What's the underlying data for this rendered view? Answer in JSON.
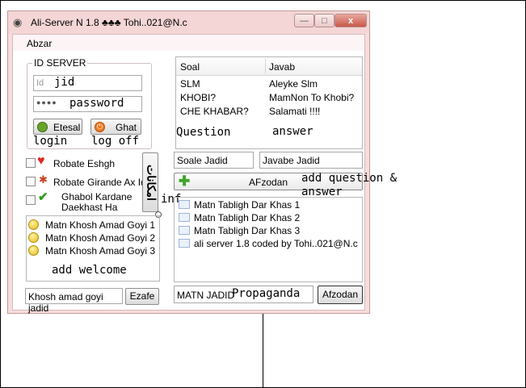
{
  "window": {
    "title": "Ali-Server N 1.8 ♣♣♣  Tohi..021@N.c",
    "menu": "Abzar",
    "close_glyph": "x",
    "minimize_glyph": "—",
    "maximize_glyph": "□"
  },
  "id_server": {
    "label": "ID SERVER",
    "jid_placeholder": "Id",
    "jid_overlay": "jid",
    "password_mask": "●●●●",
    "password_overlay": "password",
    "login_button": "Etesal",
    "logoff_button": "Ghat",
    "login_overlay": "login",
    "logoff_overlay": "log off"
  },
  "options": {
    "robate_eshgh": "Robate Eshgh",
    "robate_girande": "Robate Girande Ax Id",
    "ghabol_line1": "Ghabol Kardane",
    "ghabol_line2": "Daekhast Ha",
    "emkanat_button": "امکانات",
    "inf_overlay": "inf"
  },
  "welcome": {
    "items": [
      "Matn Khosh Amad Goyi 1",
      "Matn Khosh Amad Goyi 2",
      "Matn Khosh Amad Goyi 3"
    ],
    "overlay": "add welcome",
    "input_value": "Khosh amad goyi jadid",
    "add_button": "Ezafe"
  },
  "qa": {
    "col_question": "Soal",
    "col_answer": "Javab",
    "rows": [
      {
        "q": "SLM",
        "a": "Aleyke Slm"
      },
      {
        "q": "KHOBI?",
        "a": "MamNon To Khobi?"
      },
      {
        "q": "CHE KHABAR?",
        "a": "Salamati !!!!"
      }
    ],
    "question_overlay": "Question",
    "answer_overlay": "answer",
    "new_question": "Soale Jadid",
    "new_answer": "Javabe Jadid",
    "add_button": "AFzodan",
    "add_overlay_1": "add question &",
    "add_overlay_2": "answer"
  },
  "propaganda": {
    "items": [
      "Matn Tabligh Dar Khas 1",
      "Matn Tabligh Dar Khas 2",
      "Matn Tabligh Dar Khas 3",
      "ali server 1.8 coded by Tohi..021@N.c"
    ],
    "input_value": "MATN JADID",
    "overlay": "Propaganda",
    "add_button": "Afzodan"
  }
}
